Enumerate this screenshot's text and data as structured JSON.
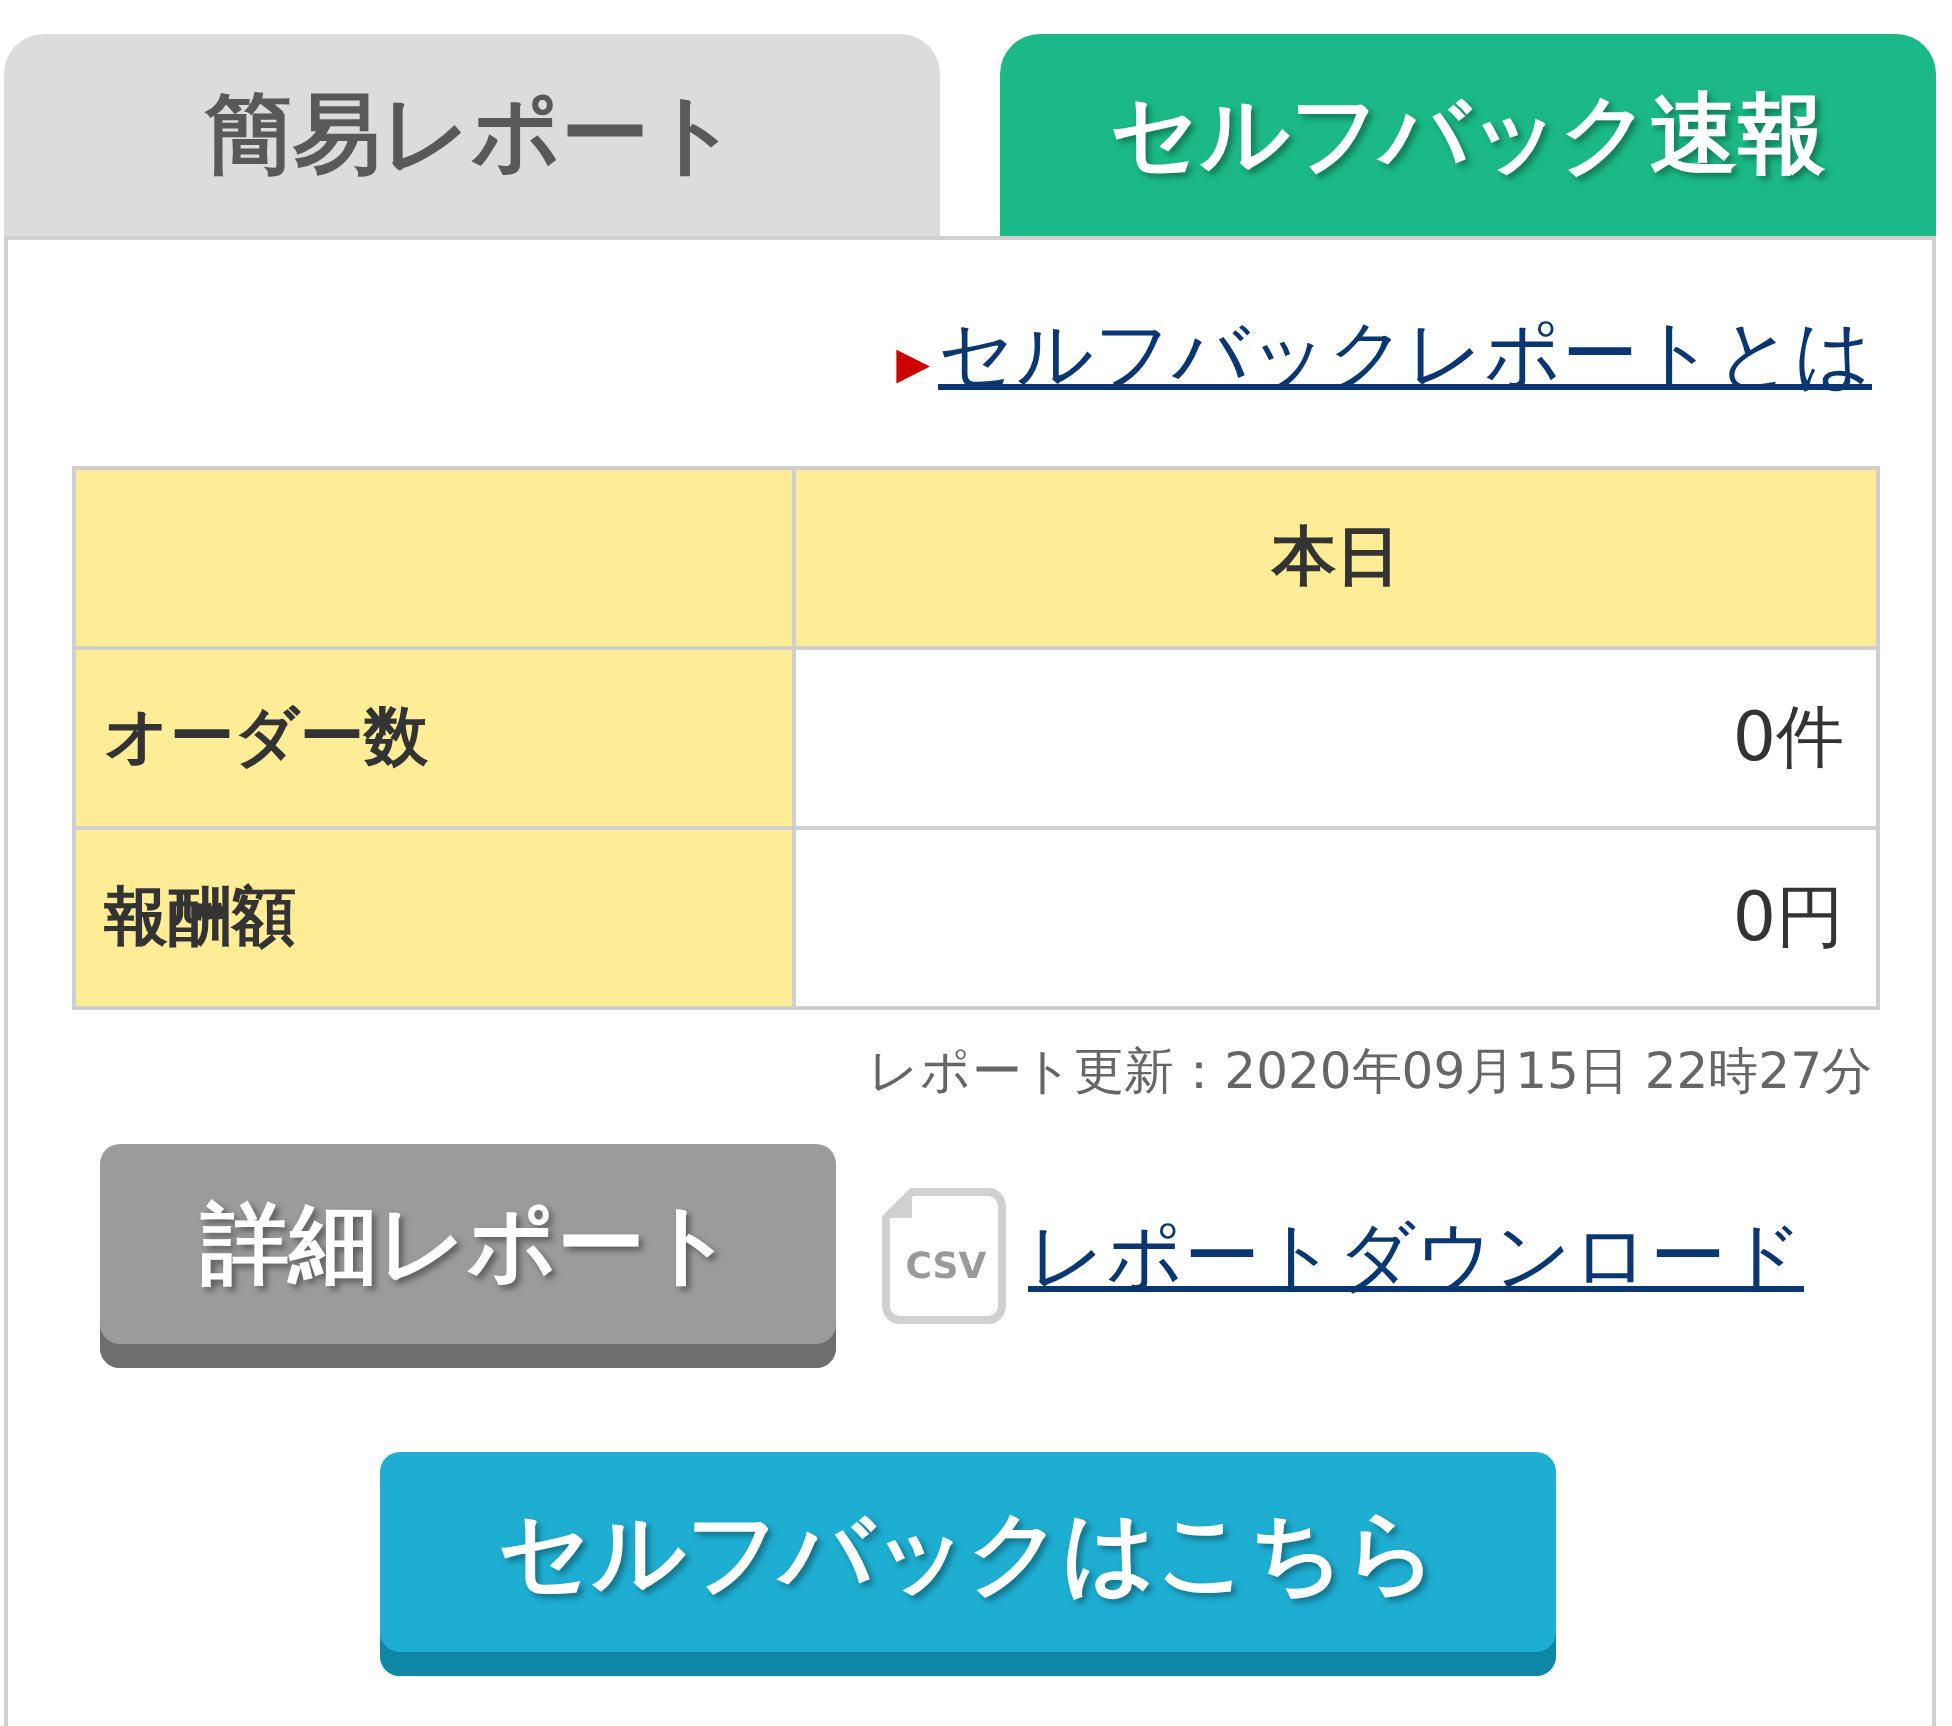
{
  "tabs": [
    {
      "label": "簡易レポート",
      "selected": false
    },
    {
      "label": "セルフバック速報",
      "selected": true
    }
  ],
  "about_link": {
    "marker": "▶",
    "label": "セルフバックレポートとは"
  },
  "table": {
    "columns": [
      "本日"
    ],
    "rows": [
      {
        "label": "オーダー数",
        "value": "0件"
      },
      {
        "label": "報酬額",
        "value": "0円"
      }
    ]
  },
  "updated": "レポート更新：2020年09月15日 22時27分",
  "detail_button": "詳細レポート",
  "download": {
    "icon_text": "CSV",
    "label": "レポートダウンロード"
  },
  "selfback_button": "セルフバックはこちら"
}
